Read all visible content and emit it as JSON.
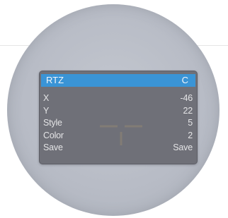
{
  "osd": {
    "header": {
      "title": "RTZ",
      "value": "C"
    },
    "rows": [
      {
        "label": "X",
        "value": "-46"
      },
      {
        "label": "Y",
        "value": "22"
      },
      {
        "label": "Style",
        "value": "5"
      },
      {
        "label": "Color",
        "value": "2"
      },
      {
        "label": "Save",
        "value": "Save"
      }
    ]
  },
  "colors": {
    "header_bg": "#3a94d6",
    "panel_bg": "#6f7078",
    "lens_bg": "#b8bcc6"
  }
}
